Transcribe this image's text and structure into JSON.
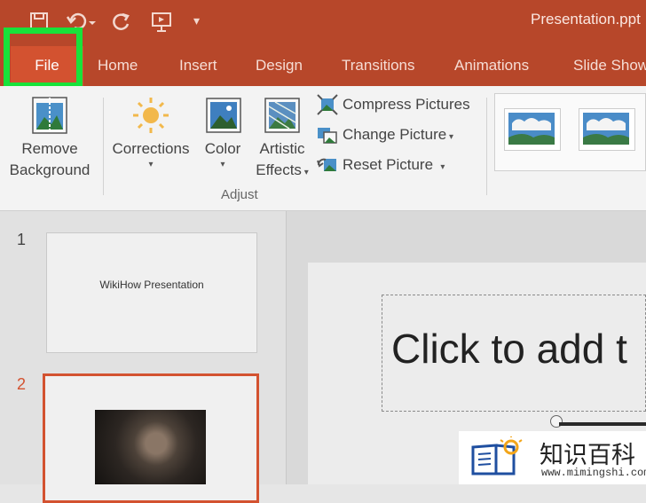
{
  "window": {
    "doc_title": "Presentation.ppt",
    "qat_icons": [
      "save-icon",
      "undo-icon",
      "redo-icon",
      "present-icon",
      "customize-icon"
    ]
  },
  "tabs": [
    {
      "label": "File",
      "active": true,
      "highlighted": true
    },
    {
      "label": "Home"
    },
    {
      "label": "Insert"
    },
    {
      "label": "Design"
    },
    {
      "label": "Transitions"
    },
    {
      "label": "Animations"
    },
    {
      "label": "Slide Show"
    }
  ],
  "ribbon": {
    "remove_bg": {
      "line1": "Remove",
      "line2": "Background"
    },
    "corrections": {
      "label": "Corrections"
    },
    "color": {
      "label": "Color"
    },
    "artistic": {
      "line1": "Artistic",
      "line2": "Effects"
    },
    "compress": "Compress Pictures",
    "change": "Change Picture",
    "reset": "Reset Picture",
    "group_label": "Adjust"
  },
  "slides": [
    {
      "number": "1",
      "title": "WikiHow Presentation"
    },
    {
      "number": "2"
    }
  ],
  "editor": {
    "placeholder_text": "Click to add t"
  },
  "watermark": {
    "text_cn": "知识百科",
    "url": "www.mimingshi.com"
  },
  "colors": {
    "accent": "#b7472a",
    "file_tab": "#d35230",
    "highlight": "#18e23a"
  }
}
